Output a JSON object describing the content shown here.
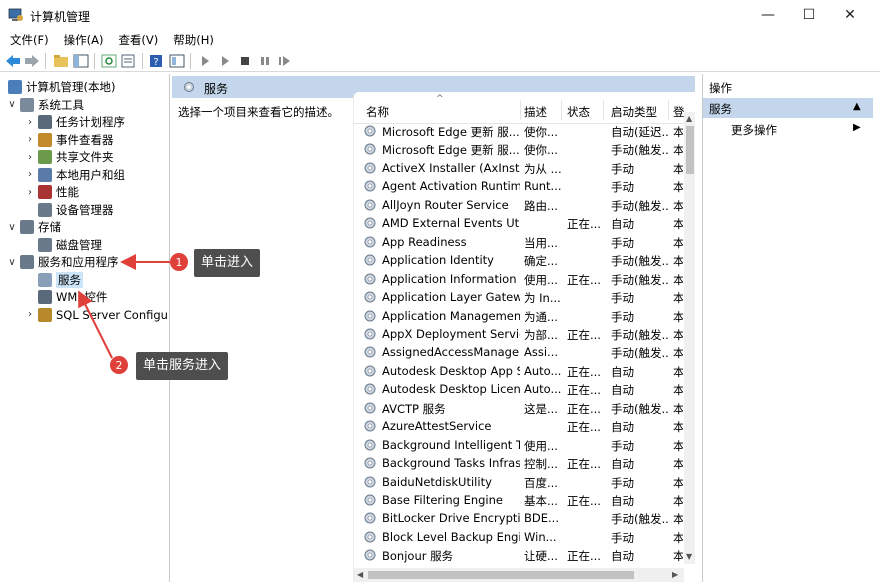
{
  "window": {
    "title": "计算机管理",
    "min": "—",
    "max": "☐",
    "close": "✕"
  },
  "menu": [
    "文件(F)",
    "操作(A)",
    "查看(V)",
    "帮助(H)"
  ],
  "tree": [
    {
      "label": "计算机管理(本地)",
      "exp": "",
      "level": 0
    },
    {
      "label": "系统工具",
      "exp": "∨",
      "level": 1
    },
    {
      "label": "任务计划程序",
      "exp": "›",
      "level": 2
    },
    {
      "label": "事件查看器",
      "exp": "›",
      "level": 2
    },
    {
      "label": "共享文件夹",
      "exp": "›",
      "level": 2
    },
    {
      "label": "本地用户和组",
      "exp": "›",
      "level": 2
    },
    {
      "label": "性能",
      "exp": "›",
      "level": 2
    },
    {
      "label": "设备管理器",
      "exp": "",
      "level": 2
    },
    {
      "label": "存储",
      "exp": "∨",
      "level": 1
    },
    {
      "label": "磁盘管理",
      "exp": "",
      "level": 2
    },
    {
      "label": "服务和应用程序",
      "exp": "∨",
      "level": 1
    },
    {
      "label": "服务",
      "exp": "",
      "level": 2,
      "selected": true
    },
    {
      "label": "WMI 控件",
      "exp": "",
      "level": 2
    },
    {
      "label": "SQL Server Configura",
      "exp": "›",
      "level": 2
    }
  ],
  "middle": {
    "header": "服务",
    "description": "选择一个项目来查看它的描述。"
  },
  "list": {
    "columns": {
      "name": "名称",
      "desc": "描述",
      "status": "状态",
      "start": "启动类型",
      "login": "登"
    },
    "rows": [
      {
        "name": "Microsoft Edge 更新 服...",
        "desc": "使你...",
        "status": "",
        "start": "自动(延迟...",
        "login": "本"
      },
      {
        "name": "Microsoft Edge 更新 服...",
        "desc": "使你...",
        "status": "",
        "start": "手动(触发...",
        "login": "本"
      },
      {
        "name": "ActiveX Installer (AxInstSV)",
        "desc": "为从 ...",
        "status": "",
        "start": "手动",
        "login": "本"
      },
      {
        "name": "Agent Activation Runtime...",
        "desc": "Runt...",
        "status": "",
        "start": "手动",
        "login": "本"
      },
      {
        "name": "AllJoyn Router Service",
        "desc": "路由...",
        "status": "",
        "start": "手动(触发...",
        "login": "本"
      },
      {
        "name": "AMD External Events Utility",
        "desc": "",
        "status": "正在...",
        "start": "自动",
        "login": "本"
      },
      {
        "name": "App Readiness",
        "desc": "当用...",
        "status": "",
        "start": "手动",
        "login": "本"
      },
      {
        "name": "Application Identity",
        "desc": "确定...",
        "status": "",
        "start": "手动(触发...",
        "login": "本"
      },
      {
        "name": "Application Information",
        "desc": "使用...",
        "status": "正在...",
        "start": "手动(触发...",
        "login": "本"
      },
      {
        "name": "Application Layer Gatewa...",
        "desc": "为 In...",
        "status": "",
        "start": "手动",
        "login": "本"
      },
      {
        "name": "Application Management",
        "desc": "为通...",
        "status": "",
        "start": "手动",
        "login": "本"
      },
      {
        "name": "AppX Deployment Servic...",
        "desc": "为部...",
        "status": "正在...",
        "start": "手动(触发...",
        "login": "本"
      },
      {
        "name": "AssignedAccessManager...",
        "desc": "Assi...",
        "status": "",
        "start": "手动(触发...",
        "login": "本"
      },
      {
        "name": "Autodesk Desktop App S...",
        "desc": "Auto...",
        "status": "正在...",
        "start": "自动",
        "login": "本"
      },
      {
        "name": "Autodesk Desktop Licens...",
        "desc": "Auto...",
        "status": "正在...",
        "start": "自动",
        "login": "本"
      },
      {
        "name": "AVCTP 服务",
        "desc": "这是...",
        "status": "正在...",
        "start": "手动(触发...",
        "login": "本"
      },
      {
        "name": "AzureAttestService",
        "desc": "",
        "status": "正在...",
        "start": "自动",
        "login": "本"
      },
      {
        "name": "Background Intelligent T...",
        "desc": "使用...",
        "status": "",
        "start": "手动",
        "login": "本"
      },
      {
        "name": "Background Tasks Infras...",
        "desc": "控制...",
        "status": "正在...",
        "start": "自动",
        "login": "本"
      },
      {
        "name": "BaiduNetdiskUtility",
        "desc": "百度...",
        "status": "",
        "start": "手动",
        "login": "本"
      },
      {
        "name": "Base Filtering Engine",
        "desc": "基本...",
        "status": "正在...",
        "start": "自动",
        "login": "本"
      },
      {
        "name": "BitLocker Drive Encryptio...",
        "desc": "BDE...",
        "status": "",
        "start": "手动(触发...",
        "login": "本"
      },
      {
        "name": "Block Level Backup Engi...",
        "desc": "Win...",
        "status": "",
        "start": "手动",
        "login": "本"
      },
      {
        "name": "Bonjour 服务",
        "desc": "让硬...",
        "status": "正在...",
        "start": "自动",
        "login": "本"
      }
    ]
  },
  "actions": {
    "title": "操作",
    "section": "服务",
    "more": "更多操作"
  },
  "callouts": [
    {
      "badge": "1",
      "text": "单击进入"
    },
    {
      "badge": "2",
      "text": "单击服务进入"
    }
  ],
  "colors": {
    "accent_bar": "#c4d6ec",
    "badge": "#e0403a",
    "callout": "#4e4e4e",
    "selected": "#cce4f7"
  }
}
